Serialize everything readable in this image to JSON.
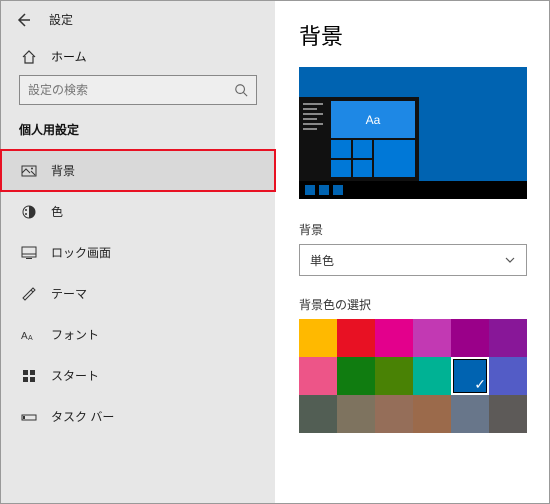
{
  "header": {
    "title": "設定"
  },
  "home": {
    "label": "ホーム"
  },
  "search": {
    "placeholder": "設定の検索"
  },
  "section_label": "個人用設定",
  "nav": [
    {
      "label": "背景",
      "selected": true
    },
    {
      "label": "色"
    },
    {
      "label": "ロック画面"
    },
    {
      "label": "テーマ"
    },
    {
      "label": "フォント"
    },
    {
      "label": "スタート"
    },
    {
      "label": "タスク バー"
    }
  ],
  "page": {
    "title": "背景"
  },
  "background_field": {
    "label": "背景",
    "value": "単色"
  },
  "color_section": {
    "label": "背景色の選択"
  },
  "preview": {
    "tile_text": "Aa"
  },
  "colors": {
    "rows": [
      [
        "#ffb900",
        "#e81123",
        "#e3008c",
        "#c239b3",
        "#9a0089",
        "#881798"
      ],
      [
        "#ed5588",
        "#107c10",
        "#498205",
        "#00b294",
        "#0063b1",
        "#535cc6"
      ],
      [
        "#525e54",
        "#7e735f",
        "#956e59",
        "#9b6a4b",
        "#68768a",
        "#5d5a58"
      ]
    ],
    "selected": [
      1,
      4
    ]
  }
}
